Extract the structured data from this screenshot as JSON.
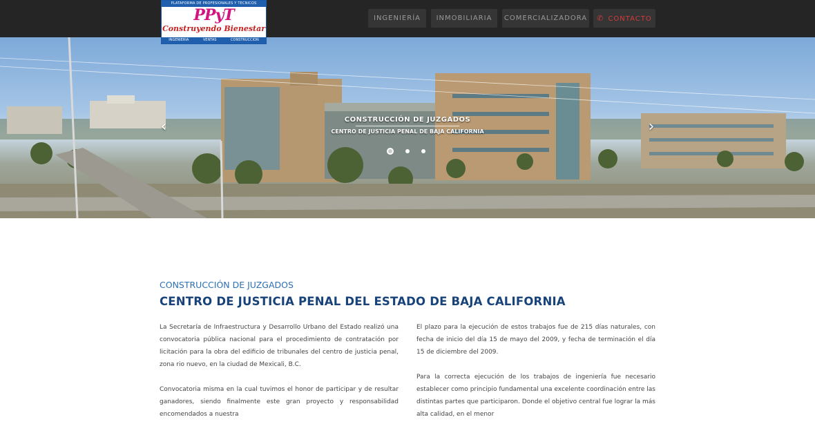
{
  "header": {
    "logo": {
      "top_text": "PLATAFORMA DE PROFESIONALES Y TECNICOS",
      "mark": "PPyT",
      "tagline": "Construyendo Bienestar",
      "bottom_items": [
        "INGENIERIA",
        "VENTAS",
        "CONSTRUCCION"
      ]
    },
    "nav": [
      {
        "label": "INGENIERÍA"
      },
      {
        "label": "INMOBILIARIA"
      },
      {
        "label": "COMERCIALIZADORA"
      },
      {
        "label": "CONTACTO",
        "icon": "phone-icon"
      }
    ]
  },
  "slider": {
    "title": "CONSTRUCCIÓN DE JUZGADOS",
    "subtitle": "CENTRO DE JUSTICIA PENAL DE BAJA CALIFORNIA",
    "prev_icon": "chevron-left-icon",
    "next_icon": "chevron-right-icon",
    "slide_count": 3,
    "active_slide": 1
  },
  "article": {
    "kicker": "CONSTRUCCIÓN DE JUZGADOS",
    "headline": "CENTRO DE JUSTICIA PENAL DEL ESTADO DE BAJA CALIFORNIA",
    "left_paragraphs": [
      "La Secretaría de Infraestructura y Desarrollo Urbano del Estado realizó una convocatoria pública nacional para el procedimiento de contratación por licitación para la obra del edificio de tribunales del centro de justicia penal, zona rio nuevo, en la ciudad de Mexicali, B.C.",
      "Convocatoria misma en la cual tuvimos el honor de participar y de resultar ganadores, siendo finalmente este gran proyecto y responsabilidad encomendados a nuestra"
    ],
    "right_paragraphs": [
      "El plazo para la ejecución de estos trabajos fue de 215 días naturales, con fecha de inicio del día 15 de mayo del 2009, y fecha de terminación el día 15 de diciembre del 2009.",
      "Para la correcta ejecución de los trabajos de ingeniería fue necesario establecer como principio fundamental una excelente coordinación entre las distintas partes que participaron. Donde el objetivo central fue lograr la más alta calidad, en el menor"
    ]
  },
  "colors": {
    "topbar": "#252525",
    "nav_button": "#353535",
    "contact_accent": "#d23c3c",
    "kicker": "#2c6fb3",
    "headline": "#17437a"
  }
}
